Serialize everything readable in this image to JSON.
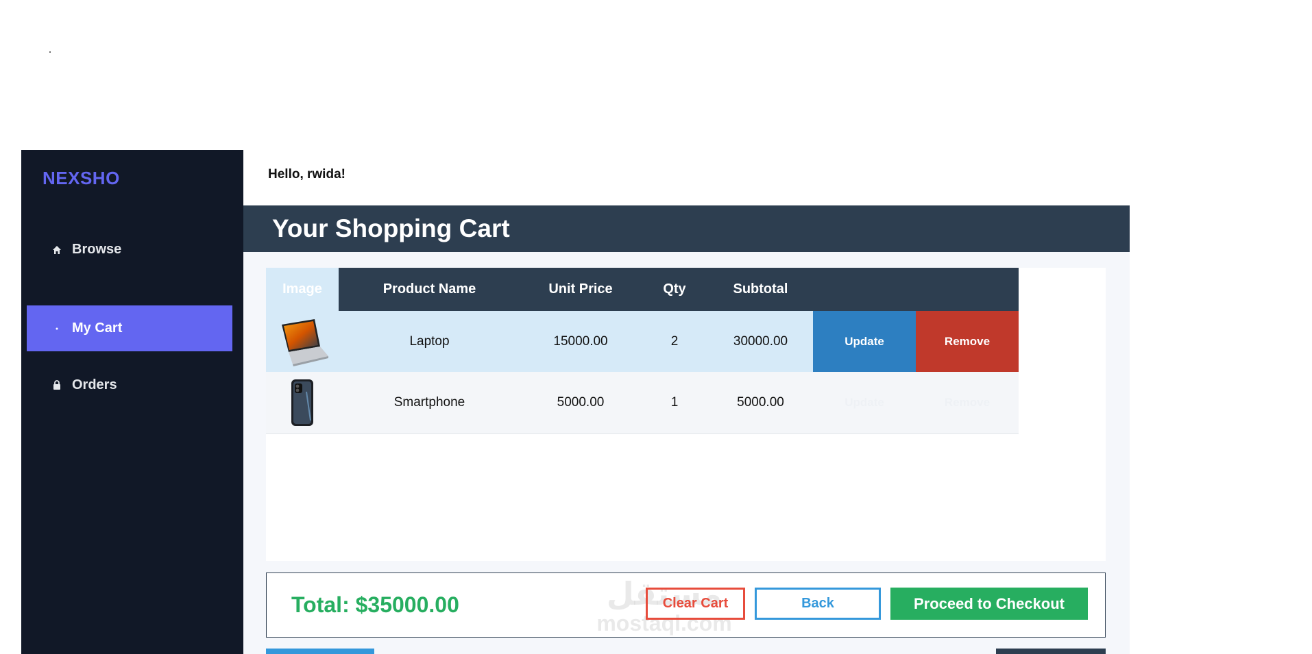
{
  "brand": {
    "name": "NEXSHO",
    "color": "#6366f1"
  },
  "sidebar": {
    "items": [
      {
        "label": "Browse",
        "icon": "home-icon",
        "active": false
      },
      {
        "label": "My Cart",
        "icon": "dot-icon",
        "active": true
      },
      {
        "label": "Orders",
        "icon": "lock-icon",
        "active": false
      }
    ]
  },
  "greeting": "Hello, rwida!",
  "cart": {
    "title": "Your Shopping Cart",
    "columns": [
      "Image",
      "Product Name",
      "Unit Price",
      "Qty",
      "Subtotal"
    ],
    "rows": [
      {
        "image": "laptop-image",
        "name": "Laptop",
        "unit_price": "15000.00",
        "qty": "2",
        "subtotal": "30000.00",
        "update_label": "Update",
        "remove_label": "Remove"
      },
      {
        "image": "smartphone-image",
        "name": "Smartphone",
        "unit_price": "5000.00",
        "qty": "1",
        "subtotal": "5000.00",
        "update_label": "Update",
        "remove_label": "Remove"
      }
    ]
  },
  "footer": {
    "total": "Total: $35000.00",
    "clear_label": "Clear Cart",
    "back_label": "Back",
    "checkout_label": "Proceed to Checkout"
  },
  "watermark": {
    "arabic": "مستقل",
    "latin": "mostaql.com"
  },
  "colors": {
    "sidebar_bg": "#111827",
    "header_bg": "#2d3e50",
    "total_green": "#27ae60",
    "remove_red": "#c0392b",
    "update_blue": "#2d7fc1"
  }
}
